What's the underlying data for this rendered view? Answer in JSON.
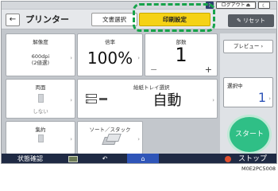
{
  "topbar": {
    "help": "?",
    "logout": "ログアウト",
    "moon": "☾"
  },
  "header": {
    "title": "プリンター",
    "tabs": [
      {
        "label": "文書選択"
      },
      {
        "label": "印刷設定"
      }
    ],
    "reset": "リセット"
  },
  "tiles": {
    "resolution": {
      "label": "解像度",
      "value_line1": "600dpi",
      "value_line2": "(2値選)"
    },
    "zoom": {
      "label": "倍率",
      "value": "100%"
    },
    "copies": {
      "label": "部数",
      "value": "1",
      "minus": "−",
      "plus": "+"
    },
    "duplex": {
      "label": "両面",
      "value": "しない"
    },
    "tray": {
      "label": "給紙トレイ選択",
      "value": "自動"
    },
    "combine": {
      "label": "集約"
    },
    "sort": {
      "label": "ソート／スタック"
    }
  },
  "side": {
    "preview": "プレビュー",
    "selected_label": "選択中",
    "selected_count": "1",
    "start": "スタート"
  },
  "bottombar": {
    "status": "状態確認",
    "stop": "ストップ"
  },
  "caption": "M0E2PC5008"
}
